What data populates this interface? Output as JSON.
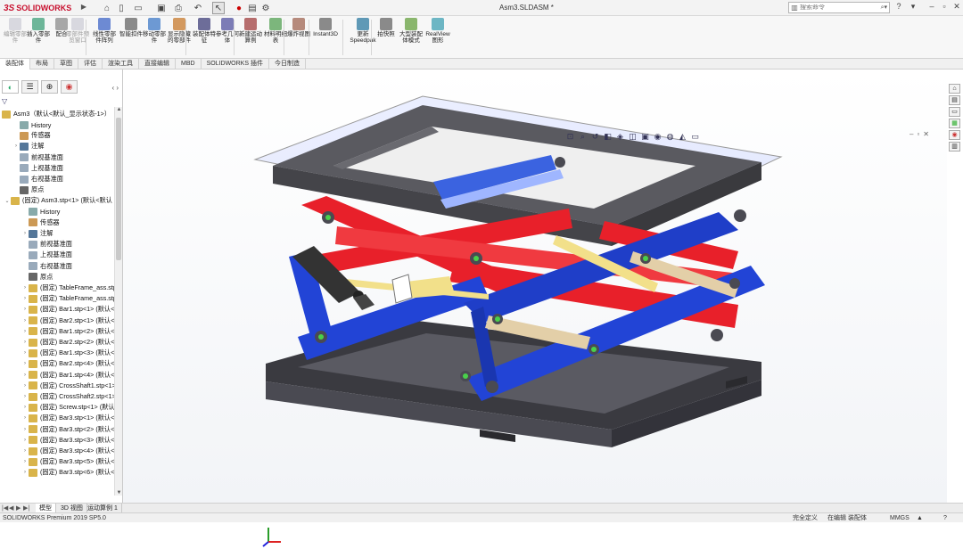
{
  "app": {
    "brand": "SOLIDWORKS",
    "brand_prefix": "3S",
    "document_title": "Asm3.SLDASM *",
    "search_placeholder": "搜索命令"
  },
  "ribbon": {
    "buttons": [
      {
        "label": "编辑零部件",
        "disabled": true
      },
      {
        "label": "插入零部件",
        "disabled": false
      },
      {
        "label": "配合",
        "disabled": false
      },
      {
        "label": "零部件预览窗口",
        "disabled": true
      },
      {
        "label": "线性零部件阵列",
        "disabled": false
      },
      {
        "label": "智能扣件",
        "disabled": false
      },
      {
        "label": "移动零部件",
        "disabled": false
      },
      {
        "label": "显示隐藏的零部件",
        "disabled": false
      },
      {
        "label": "装配体特征",
        "disabled": false
      },
      {
        "label": "参考几何体",
        "disabled": false
      },
      {
        "label": "新建运动算例",
        "disabled": false
      },
      {
        "label": "材料明细表",
        "disabled": false
      },
      {
        "label": "爆炸视图",
        "disabled": false
      },
      {
        "label": "Instant3D",
        "disabled": false
      },
      {
        "label": "更新Speedpak",
        "disabled": false
      },
      {
        "label": "拍快照",
        "disabled": false
      },
      {
        "label": "大型装配体模式",
        "disabled": false
      },
      {
        "label": "RealView图形",
        "disabled": false
      }
    ]
  },
  "command_tabs": [
    "装配体",
    "布局",
    "草图",
    "评估",
    "渲染工具",
    "直接编辑",
    "MBD",
    "SOLIDWORKS 插件",
    "今日制造"
  ],
  "active_command_tab": 0,
  "tree": {
    "root": "Asm3（默认<默认_显示状态-1>）",
    "items": [
      {
        "indent": 1,
        "expander": "",
        "icon": "history-icon",
        "label": "History"
      },
      {
        "indent": 1,
        "expander": "",
        "icon": "sensor-icon",
        "label": "传感器"
      },
      {
        "indent": 1,
        "expander": "›",
        "icon": "annotation-icon",
        "label": "注解"
      },
      {
        "indent": 1,
        "expander": "",
        "icon": "plane-icon",
        "label": "前视基准面"
      },
      {
        "indent": 1,
        "expander": "",
        "icon": "plane-icon",
        "label": "上视基准面"
      },
      {
        "indent": 1,
        "expander": "",
        "icon": "plane-icon",
        "label": "右视基准面"
      },
      {
        "indent": 1,
        "expander": "",
        "icon": "origin-icon",
        "label": "原点"
      },
      {
        "indent": 0,
        "expander": "⌄",
        "icon": "subassembly-icon",
        "label": "(固定) Asm3.stp<1> (默认<默认"
      },
      {
        "indent": 2,
        "expander": "",
        "icon": "history-icon",
        "label": "History"
      },
      {
        "indent": 2,
        "expander": "",
        "icon": "sensor-icon",
        "label": "传感器"
      },
      {
        "indent": 2,
        "expander": "›",
        "icon": "annotation-icon",
        "label": "注解"
      },
      {
        "indent": 2,
        "expander": "",
        "icon": "plane-icon",
        "label": "前视基准面"
      },
      {
        "indent": 2,
        "expander": "",
        "icon": "plane-icon",
        "label": "上视基准面"
      },
      {
        "indent": 2,
        "expander": "",
        "icon": "plane-icon",
        "label": "右视基准面"
      },
      {
        "indent": 2,
        "expander": "",
        "icon": "origin-icon",
        "label": "原点"
      },
      {
        "indent": 2,
        "expander": "›",
        "icon": "subassembly-icon",
        "label": "(固定) TableFrame_ass.stp"
      },
      {
        "indent": 2,
        "expander": "›",
        "icon": "subassembly-icon",
        "label": "(固定) TableFrame_ass.stp"
      },
      {
        "indent": 2,
        "expander": "›",
        "icon": "subassembly-icon",
        "label": "(固定) Bar1.stp<1> (默认<"
      },
      {
        "indent": 2,
        "expander": "›",
        "icon": "subassembly-icon",
        "label": "(固定) Bar2.stp<1> (默认<"
      },
      {
        "indent": 2,
        "expander": "›",
        "icon": "subassembly-icon",
        "label": "(固定) Bar1.stp<2> (默认<"
      },
      {
        "indent": 2,
        "expander": "›",
        "icon": "subassembly-icon",
        "label": "(固定) Bar2.stp<2> (默认<"
      },
      {
        "indent": 2,
        "expander": "›",
        "icon": "subassembly-icon",
        "label": "(固定) Bar1.stp<3> (默认<"
      },
      {
        "indent": 2,
        "expander": "›",
        "icon": "subassembly-icon",
        "label": "(固定) Bar2.stp<4> (默认<"
      },
      {
        "indent": 2,
        "expander": "›",
        "icon": "subassembly-icon",
        "label": "(固定) Bar1.stp<4> (默认<"
      },
      {
        "indent": 2,
        "expander": "›",
        "icon": "subassembly-icon",
        "label": "(固定) CrossShaft1.stp<1>"
      },
      {
        "indent": 2,
        "expander": "›",
        "icon": "subassembly-icon",
        "label": "(固定) CrossShaft2.stp<1>"
      },
      {
        "indent": 2,
        "expander": "›",
        "icon": "subassembly-icon",
        "label": "(固定) Screw.stp<1> (默认"
      },
      {
        "indent": 2,
        "expander": "›",
        "icon": "subassembly-icon",
        "label": "(固定) Bar3.stp<1> (默认<"
      },
      {
        "indent": 2,
        "expander": "›",
        "icon": "subassembly-icon",
        "label": "(固定) Bar3.stp<2> (默认<"
      },
      {
        "indent": 2,
        "expander": "›",
        "icon": "subassembly-icon",
        "label": "(固定) Bar3.stp<3> (默认<"
      },
      {
        "indent": 2,
        "expander": "›",
        "icon": "subassembly-icon",
        "label": "(固定) Bar3.stp<4> (默认<"
      },
      {
        "indent": 2,
        "expander": "›",
        "icon": "subassembly-icon",
        "label": "(固定) Bar3.stp<5> (默认<"
      },
      {
        "indent": 2,
        "expander": "›",
        "icon": "subassembly-icon",
        "label": "(固定) Bar3.stp<6> (默认<"
      }
    ]
  },
  "bottom_tabs": [
    "模型",
    "3D 视图",
    "运动算例 1"
  ],
  "active_bottom_tab": 0,
  "status": {
    "product": "SOLIDWORKS Premium 2019 SP5.0",
    "definition": "完全定义",
    "mode": "在编辑 装配体",
    "units": "MMGS"
  },
  "colors": {
    "frame": "#4a4a52",
    "red_bar": "#e8202a",
    "blue_bar": "#2244d6",
    "shaft": "#f2e08a",
    "glass": "#9fb6ff"
  }
}
